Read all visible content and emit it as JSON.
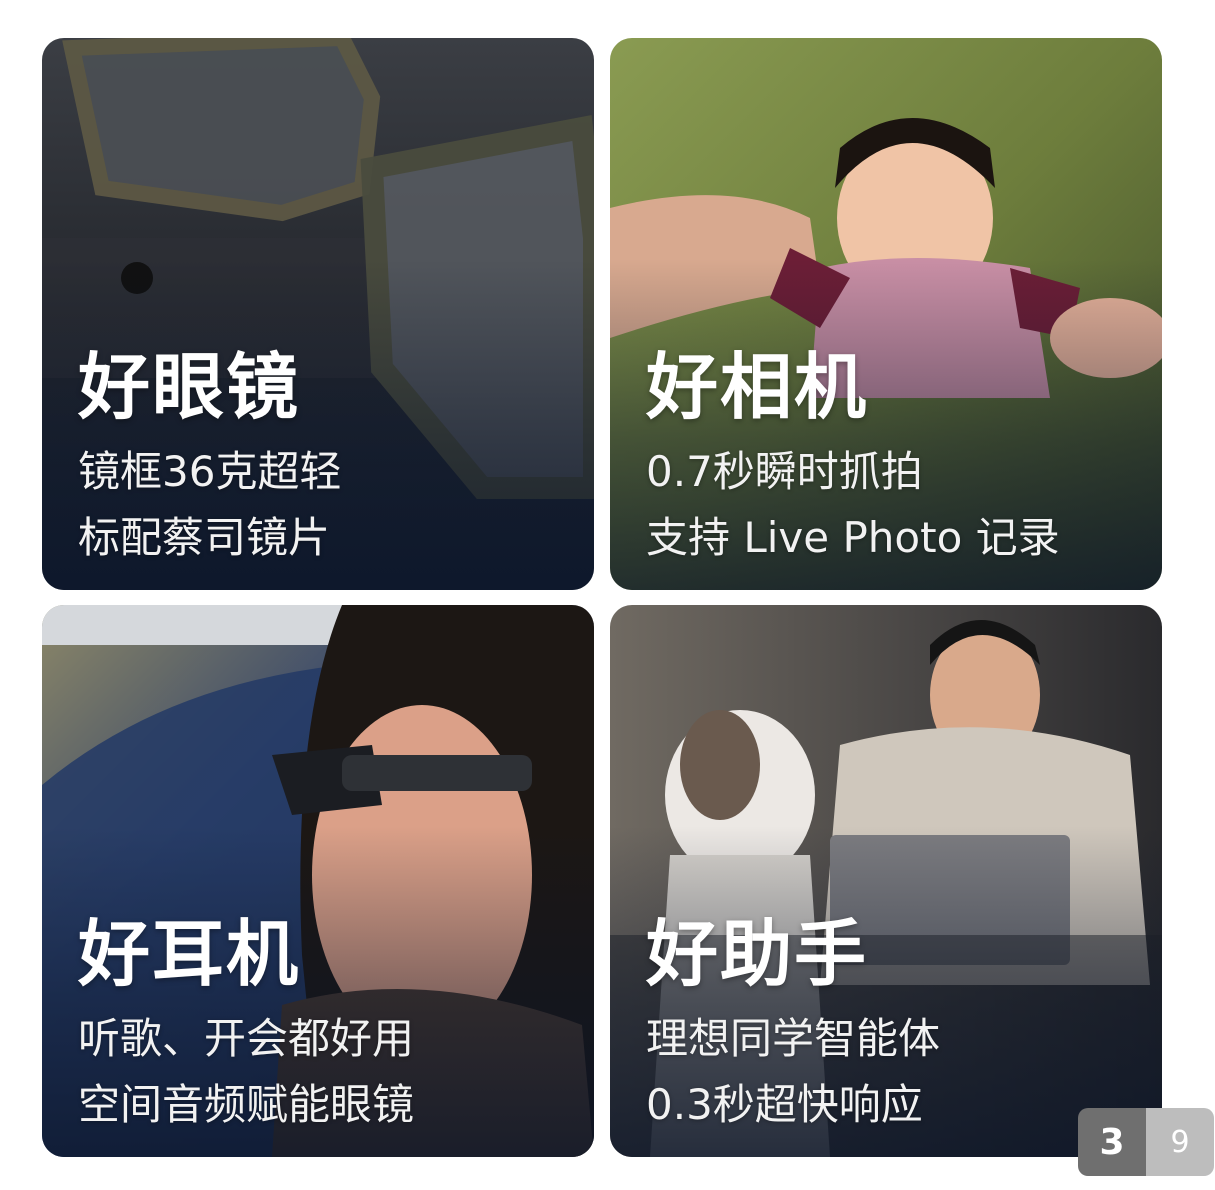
{
  "cards": [
    {
      "title": "好眼镜",
      "line1": "镜框36克超轻",
      "line2": "标配蔡司镜片"
    },
    {
      "title": "好相机",
      "line1": "0.7秒瞬时抓拍",
      "line2": "支持 Live Photo 记录"
    },
    {
      "title": "好耳机",
      "line1": "听歌、开会都好用",
      "line2": "空间音频赋能眼镜"
    },
    {
      "title": "好助手",
      "line1": "理想同学智能体",
      "line2": "0.3秒超快响应"
    }
  ],
  "pager": {
    "current": "3",
    "total": "9"
  }
}
